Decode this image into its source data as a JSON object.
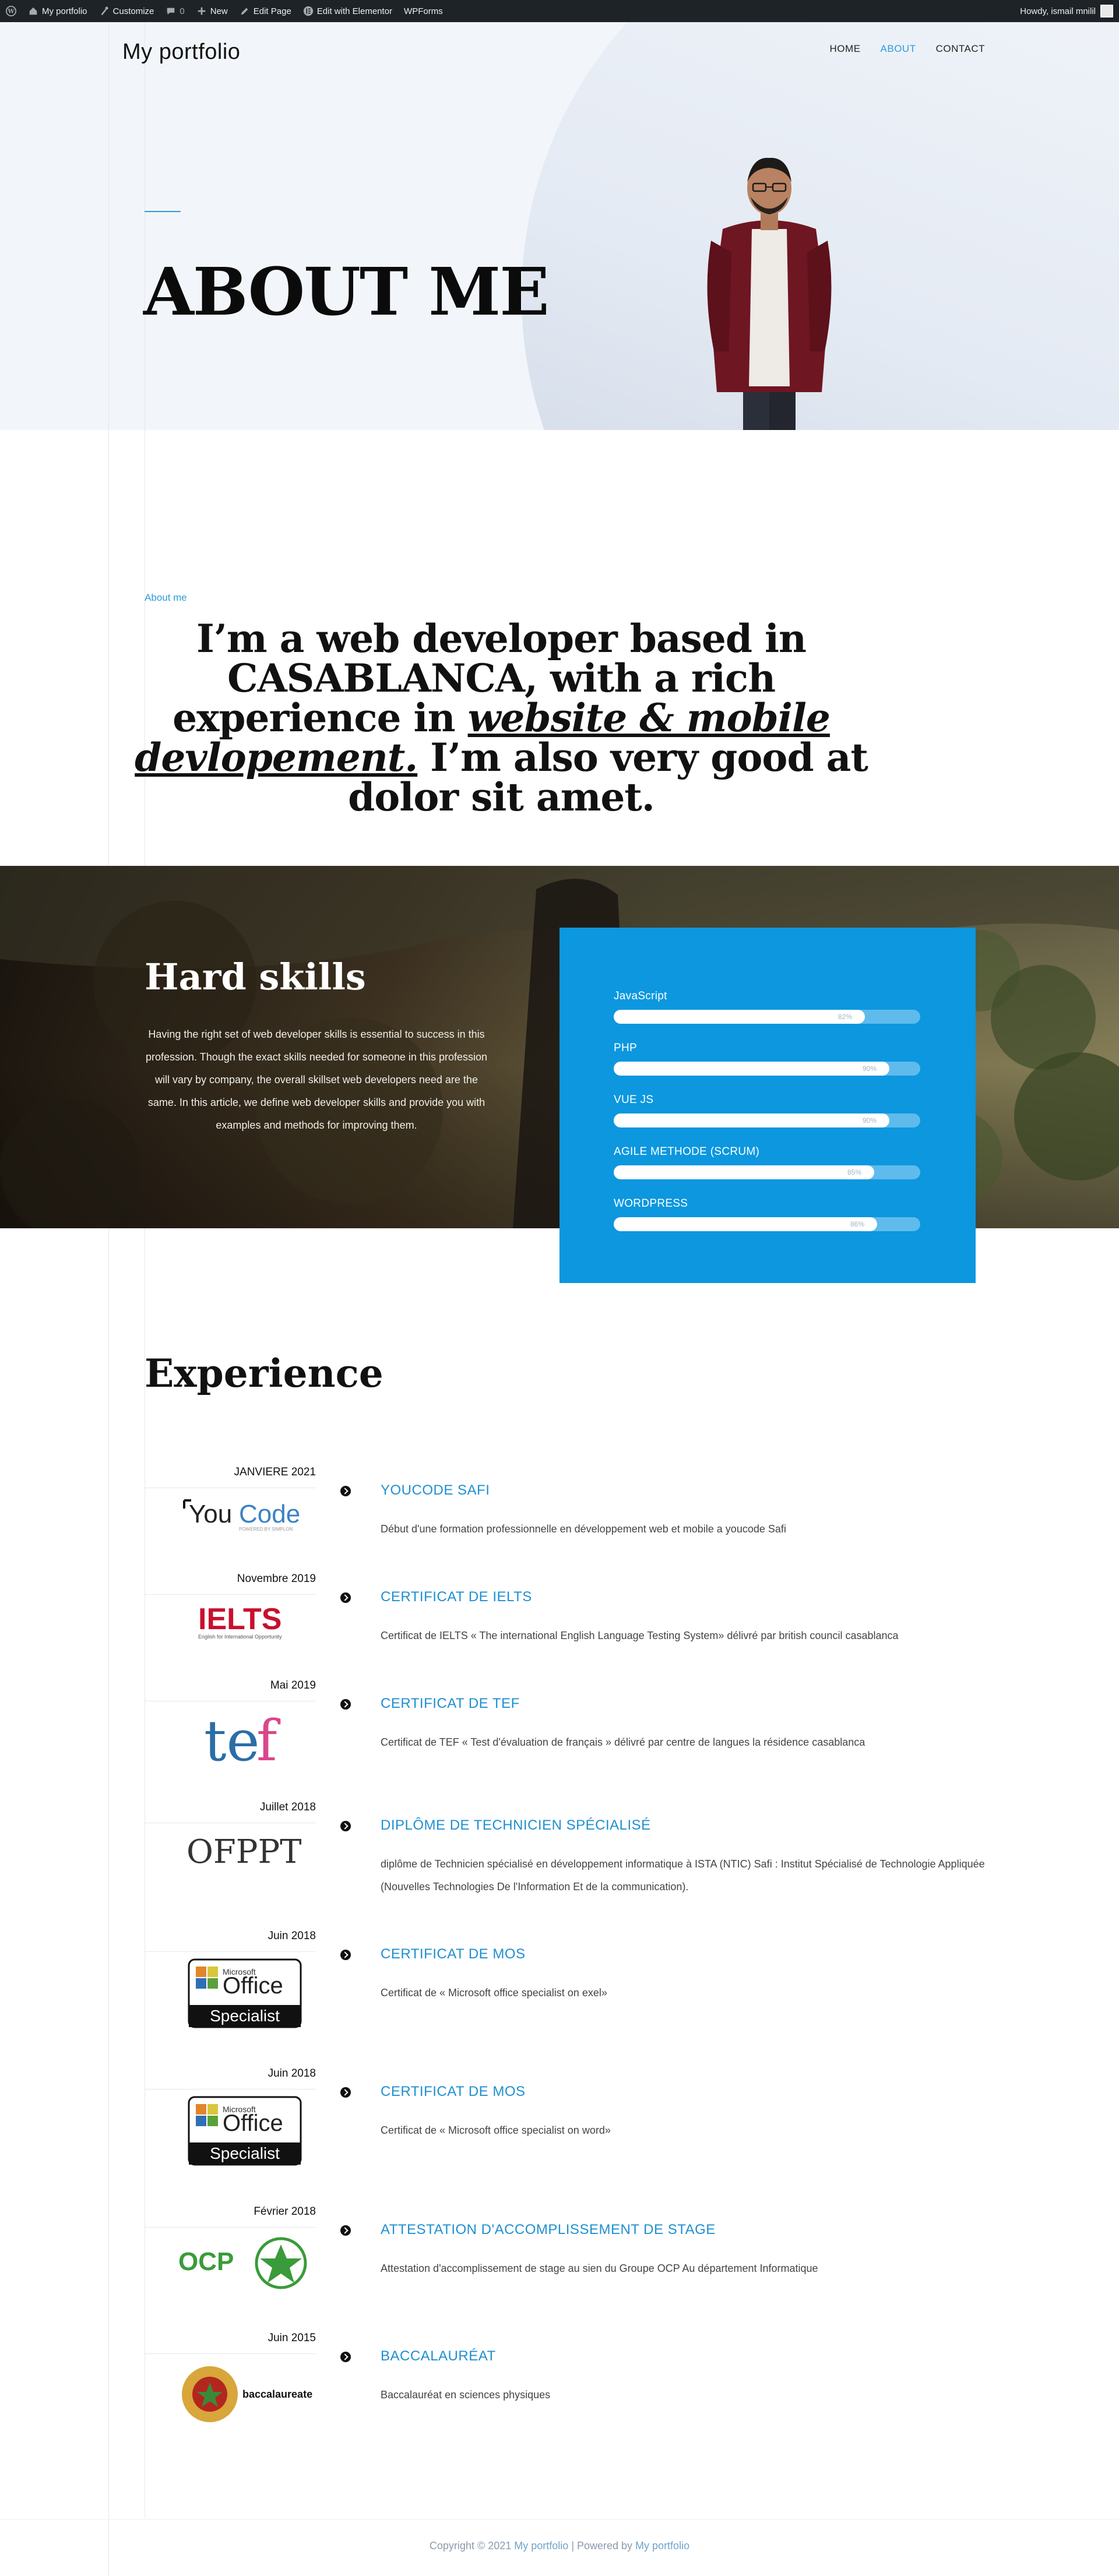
{
  "adminbar": {
    "items": [
      {
        "label": "My portfolio",
        "icon": "wordpress-icon"
      },
      {
        "label": "Customize",
        "icon": "brush-icon"
      },
      {
        "label": "0",
        "icon": "comment-icon"
      },
      {
        "label": "New",
        "icon": "plus-icon"
      },
      {
        "label": "Edit Page",
        "icon": "pencil-icon"
      },
      {
        "label": "Edit with Elementor",
        "icon": "elementor-icon"
      },
      {
        "label": "WPForms",
        "icon": ""
      }
    ],
    "greeting": "Howdy, ismail mnilil"
  },
  "header": {
    "site_title": "My portfolio",
    "nav": [
      {
        "label": "HOME",
        "active": false
      },
      {
        "label": "ABOUT",
        "active": true
      },
      {
        "label": "CONTACT",
        "active": false
      }
    ]
  },
  "hero": {
    "title": "ABOUT ME"
  },
  "about": {
    "kicker": "About me",
    "text_before": "I’m a web developer based in CASABLANCA, with a rich experience in ",
    "text_emphasis": "website & mobile devlopement.",
    "text_after": " I’m also very good at dolor sit amet."
  },
  "skills": {
    "title": "Hard skills",
    "description": "Having the right set of web developer skills is essential to success in this profession. Though the exact skills needed for someone in this profession will vary by company, the overall skillset web developers need are the same. In this article, we define web developer skills and provide you with examples and methods for improving them.",
    "items": [
      {
        "label": "JavaScript",
        "value": 82,
        "value_text": "82%"
      },
      {
        "label": "PHP",
        "value": 90,
        "value_text": "90%"
      },
      {
        "label": "VUE JS",
        "value": 90,
        "value_text": "90%"
      },
      {
        "label": "AGILE METHODE (SCRUM)",
        "value": 85,
        "value_text": "85%"
      },
      {
        "label": "WORDPRESS",
        "value": 86,
        "value_text": "86%"
      }
    ]
  },
  "experience": {
    "title": "Experience",
    "items": [
      {
        "date": "JANVIERE 2021",
        "logo": "youcode-logo",
        "logo_text": "YouCode",
        "heading": "YOUCODE SAFI",
        "description": "Début d'une formation professionnelle en développement web et mobile a youcode Safi"
      },
      {
        "date": "Novembre 2019",
        "logo": "ielts-logo",
        "logo_text": "IELTS",
        "heading": "CERTIFICAT DE IELTS",
        "description": "Certificat de IELTS « The international English Language Testing System» délivré par british council casablanca"
      },
      {
        "date": "Mai 2019",
        "logo": "tef-logo",
        "logo_text": "tef",
        "heading": "CERTIFICAT DE TEF",
        "description": "Certificat de TEF « Test d'évaluation de français » délivré par centre de langues la résidence casablanca"
      },
      {
        "date": "Juillet 2018",
        "logo": "ofppt-logo",
        "logo_text": "OFPPT",
        "heading": "DIPLÔME DE TECHNICIEN SPÉCIALISÉ",
        "description": "diplôme de Technicien spécialisé en développement informatique à ISTA (NTIC) Safi : Institut Spécialisé de Technologie Appliquée (Nouvelles Technologies De l'Information Et de la communication)."
      },
      {
        "date": "Juin 2018",
        "logo": "microsoft-office-specialist-logo",
        "logo_text": "Office",
        "heading": "CERTIFICAT DE MOS",
        "description": "Certificat de « Microsoft office specialist on exel»"
      },
      {
        "date": "Juin 2018",
        "logo": "microsoft-office-specialist-logo",
        "logo_text": "Office",
        "heading": "CERTIFICAT DE MOS",
        "description": "Certificat de « Microsoft office specialist on word»"
      },
      {
        "date": "Février 2018",
        "logo": "ocp-logo",
        "logo_text": "OCP",
        "heading": "ATTESTATION D'ACCOMPLISSEMENT DE STAGE",
        "description": "Attestation d'accomplissement de stage au sien du Groupe OCP Au département Informatique"
      },
      {
        "date": "Juin 2015",
        "logo": "baccalaureate-logo",
        "logo_text": "baccalaureate",
        "heading": "BACCALAURÉAT",
        "description": "Baccalauréat en sciences physiques"
      }
    ]
  },
  "footer": {
    "text_prefix": "Copyright © 2021 ",
    "link1": "My portfolio",
    "separator": " | Powered by ",
    "link2": "My portfolio"
  },
  "colors": {
    "accent": "#2f9bd8",
    "skill_card": "#0c97df",
    "adminbar": "#1d2327",
    "hero_bg": "#f2f6fa"
  }
}
